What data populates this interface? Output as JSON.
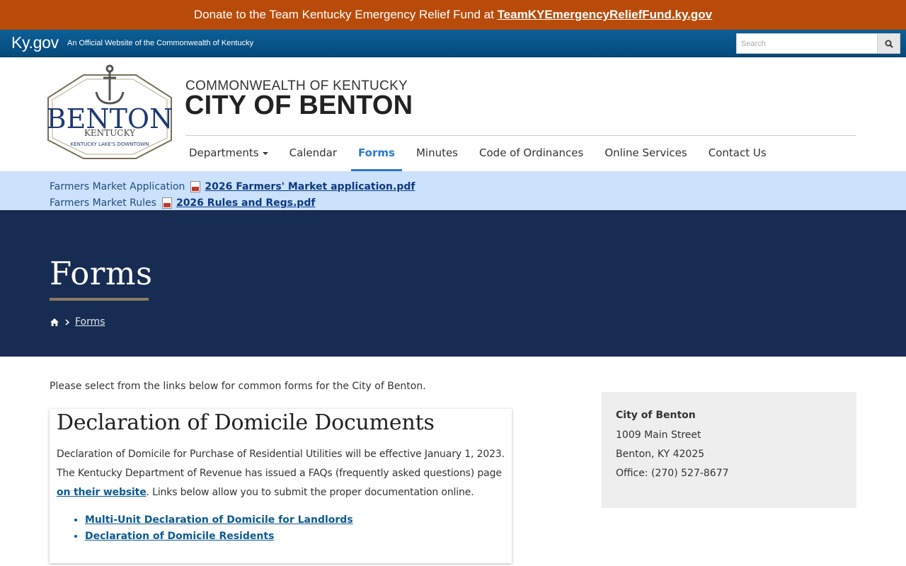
{
  "donate_banner": {
    "text": "Donate to the Team Kentucky Emergency Relief Fund at",
    "link": "TeamKYEmergencyReliefFund.ky.gov"
  },
  "kygov": {
    "logo": "Ky.gov",
    "tagline": "An Official Website of the Commonwealth of Kentucky",
    "search_placeholder": "Search"
  },
  "logo": {
    "word": "BENTON",
    "state": "KENTUCKY",
    "motto": "KENTUCKY LAKE'S DOWNTOWN"
  },
  "header": {
    "subtitle": "COMMONWEALTH OF KENTUCKY",
    "title": "CITY OF BENTON"
  },
  "nav": [
    {
      "label": "Departments",
      "dropdown": true
    },
    {
      "label": "Calendar"
    },
    {
      "label": "Forms",
      "active": true
    },
    {
      "label": "Minutes"
    },
    {
      "label": "Code of Ordinances"
    },
    {
      "label": "Online Services"
    },
    {
      "label": "Contact Us"
    }
  ],
  "alerts": [
    {
      "label": "Farmers Market Application",
      "link": "2026 Farmers' Market application.pdf"
    },
    {
      "label": "Farmers Market Rules",
      "link": "2026 Rules and Regs.pdf"
    }
  ],
  "hero": {
    "title": "Forms",
    "breadcrumb": "Forms"
  },
  "content": {
    "intro": "Please select from the links below for common forms for the City of Benton.",
    "card": {
      "title": "Declaration of Domicile Documents",
      "line1": "Declaration of Domicile for Purchase of Residential Utilities will be effective January 1, 2023.",
      "line2": "The Kentucky Department of Revenue has issued a FAQs (frequently asked questions) page",
      "link": "on their website",
      "line3": ". Links below allow you to submit the proper documentation online.",
      "items": [
        "Multi-Unit Declaration of Domicile for Landlords",
        "Declaration of Domicile Residents"
      ]
    }
  },
  "sidebar": {
    "name": "City of Benton",
    "street": "1009 Main Street",
    "city": "Benton, KY 42025",
    "phone": "Office: (270) 527-8677"
  },
  "colors": {
    "donate_bg": "#b94b0a",
    "kybar": "#0c5f97",
    "alert_bg": "#cce1fb",
    "hero_bg": "#172c52",
    "accent": "#2b78cf"
  }
}
